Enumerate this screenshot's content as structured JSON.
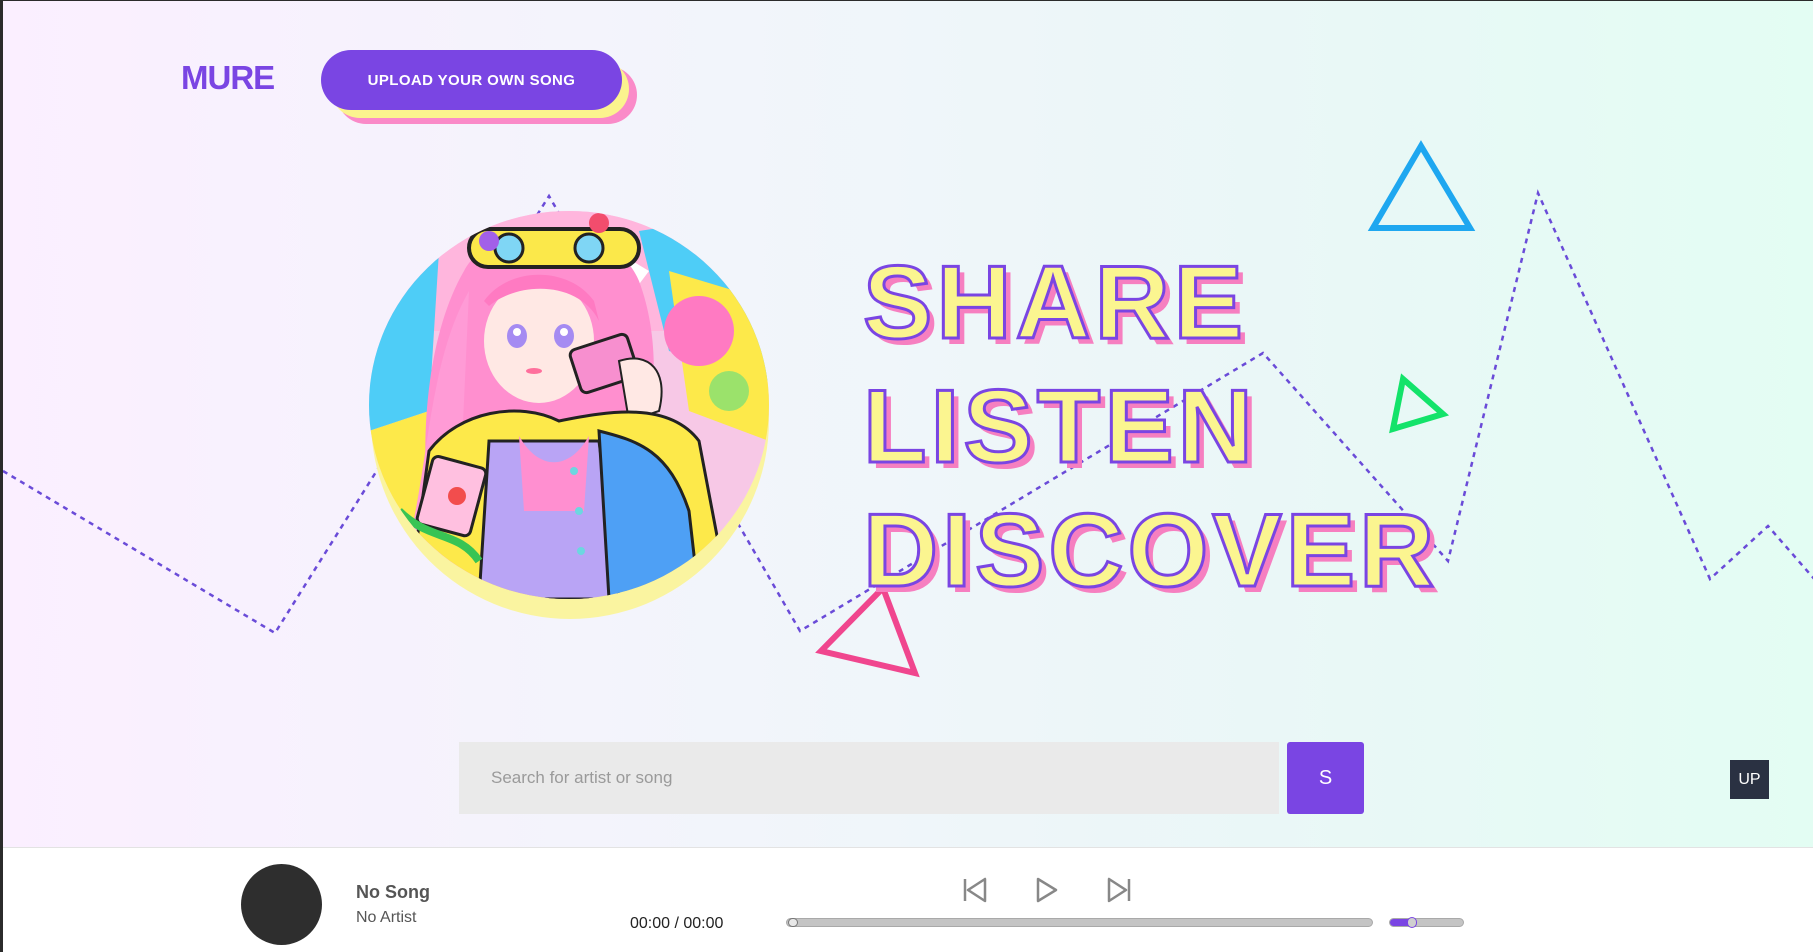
{
  "header": {
    "logo": "MURE",
    "upload_label": "UPLOAD YOUR OWN SONG"
  },
  "hero": {
    "lines": [
      "SHARE",
      "LISTEN",
      "DISCOVER"
    ]
  },
  "search": {
    "placeholder": "Search for artist or song",
    "value": "",
    "button_label": "S"
  },
  "up_button": {
    "label": "UP"
  },
  "player": {
    "song_title": "No Song",
    "song_artist": "No Artist",
    "time": "00:00 / 00:00",
    "progress_fraction": 0,
    "volume_fraction": 0.3,
    "controls": [
      "skip-back-icon",
      "play-icon",
      "skip-forward-icon"
    ]
  },
  "colors": {
    "accent": "#7a45e3",
    "hero_fill": "#fbf590",
    "hero_shadow": "#f67fc0",
    "triangle_blue": "#1ea7f0",
    "triangle_green": "#13e36a",
    "triangle_pink": "#f0468e"
  },
  "icons": {
    "album_art": "anime-girl-album-art"
  }
}
